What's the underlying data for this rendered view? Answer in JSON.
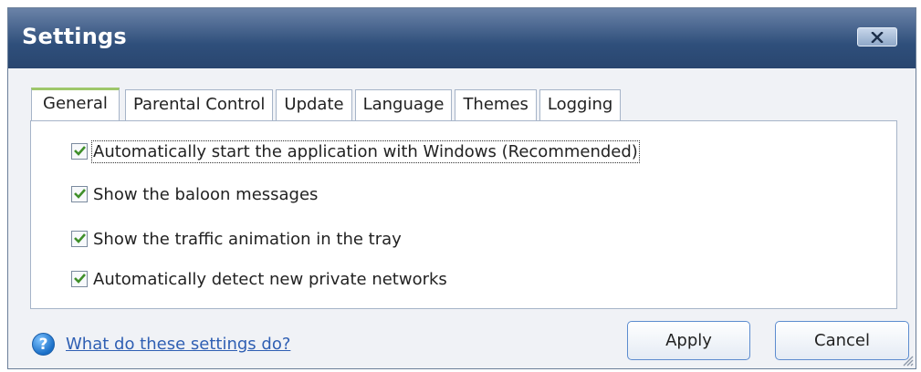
{
  "window": {
    "title": "Settings"
  },
  "tabs": [
    {
      "label": "General",
      "active": true
    },
    {
      "label": "Parental Control",
      "active": false
    },
    {
      "label": "Update",
      "active": false
    },
    {
      "label": "Language",
      "active": false
    },
    {
      "label": "Themes",
      "active": false
    },
    {
      "label": "Logging",
      "active": false
    }
  ],
  "options": [
    {
      "label": "Automatically start the application with Windows (Recommended)",
      "checked": true
    },
    {
      "label": "Show the baloon messages",
      "checked": true
    },
    {
      "label": "Show the traffic animation in the tray",
      "checked": true
    },
    {
      "label": "Automatically detect new private networks",
      "checked": true
    }
  ],
  "help": {
    "link_text": "What do these settings do?",
    "icon": "question-icon"
  },
  "buttons": {
    "apply": "Apply",
    "cancel": "Cancel"
  },
  "colors": {
    "titlebar": "#2f4f7b",
    "active_tab_accent": "#9ec76a",
    "check": "#3f8f2a",
    "link": "#2f5fb3"
  }
}
